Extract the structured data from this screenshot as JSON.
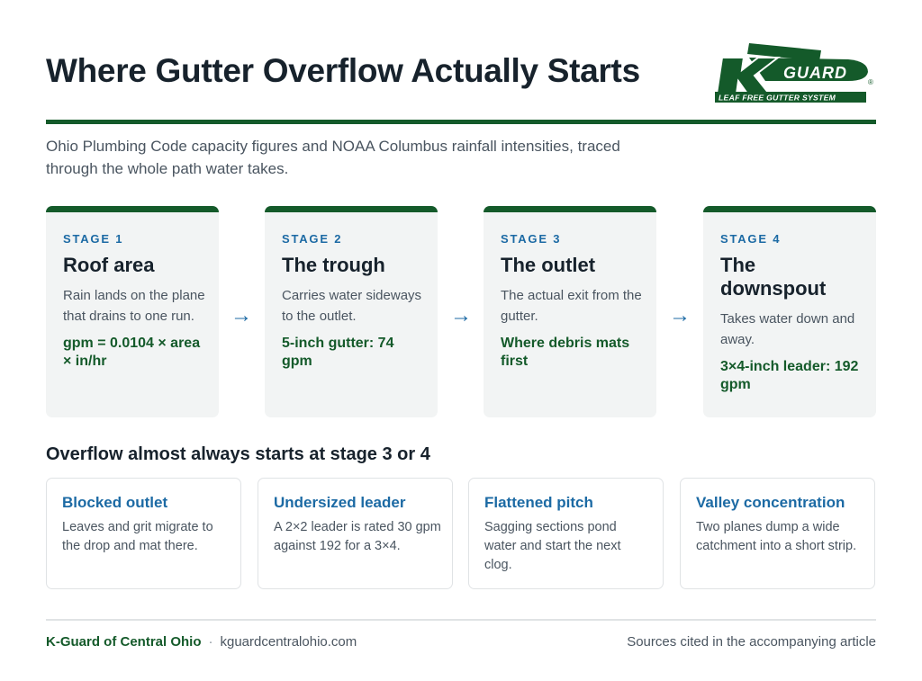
{
  "header": {
    "title": "Where Gutter Overflow Actually Starts",
    "subtitle": "Ohio Plumbing Code capacity figures and NOAA Columbus rainfall intensities, traced through the whole path water takes."
  },
  "logo": {
    "letter": "K",
    "word": "GUARD",
    "tagline": "LEAF FREE GUTTER SYSTEM",
    "mark": "®",
    "color": "#145a2a"
  },
  "stages": [
    {
      "label": "STAGE 1",
      "title": "Roof area",
      "description": "Rain lands on the plane that drains to one run.",
      "highlight": "gpm = 0.0104 × area × in/hr"
    },
    {
      "label": "STAGE 2",
      "title": "The trough",
      "description": "Carries water sideways to the outlet.",
      "highlight": "5-inch gutter: 74 gpm"
    },
    {
      "label": "STAGE 3",
      "title": "The outlet",
      "description": "The actual exit from the gutter.",
      "highlight": "Where debris mats first"
    },
    {
      "label": "STAGE 4",
      "title": "The downspout",
      "description": "Takes water down and away.",
      "highlight": "3×4-inch leader: 192 gpm"
    }
  ],
  "arrows": [
    "→",
    "→",
    "→"
  ],
  "causes": {
    "heading": "Overflow almost always starts at stage 3 or 4",
    "items": [
      {
        "title": "Blocked outlet",
        "description": "Leaves and grit migrate to the drop and mat there."
      },
      {
        "title": "Undersized leader",
        "description": "A 2×2 leader is rated 30 gpm against 192 for a 3×4."
      },
      {
        "title": "Flattened pitch",
        "description": "Sagging sections pond water and start the next clog."
      },
      {
        "title": "Valley concentration",
        "description": "Two planes dump a wide catchment into a short strip."
      }
    ]
  },
  "footer": {
    "brand": "K-Guard of Central Ohio",
    "separator": "·",
    "url": "kguardcentralohio.com",
    "note": "Sources cited in the accompanying article"
  },
  "colors": {
    "brand_green": "#145a2a",
    "accent_blue": "#1c6aa4",
    "card_bg": "#f2f4f4"
  }
}
